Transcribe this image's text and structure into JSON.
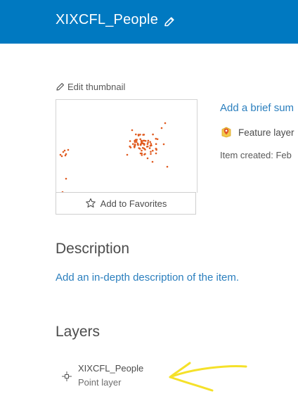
{
  "header": {
    "title": "XIXCFL_People"
  },
  "thumbnail": {
    "edit_label": "Edit thumbnail",
    "favorites_label": "Add to Favorites"
  },
  "overview": {
    "summary_link": "Add a brief sum",
    "item_type": "Feature layer",
    "created": "Item created: Feb"
  },
  "description": {
    "heading": "Description",
    "link": "Add an in-depth description of the item."
  },
  "layers": {
    "heading": "Layers",
    "items": [
      {
        "name": "XIXCFL_People",
        "type": "Point layer"
      }
    ]
  },
  "colors": {
    "header": "#0079c1",
    "link": "#2b7fbe",
    "point": "#e05a1f",
    "annotation": "#f5e12a"
  }
}
